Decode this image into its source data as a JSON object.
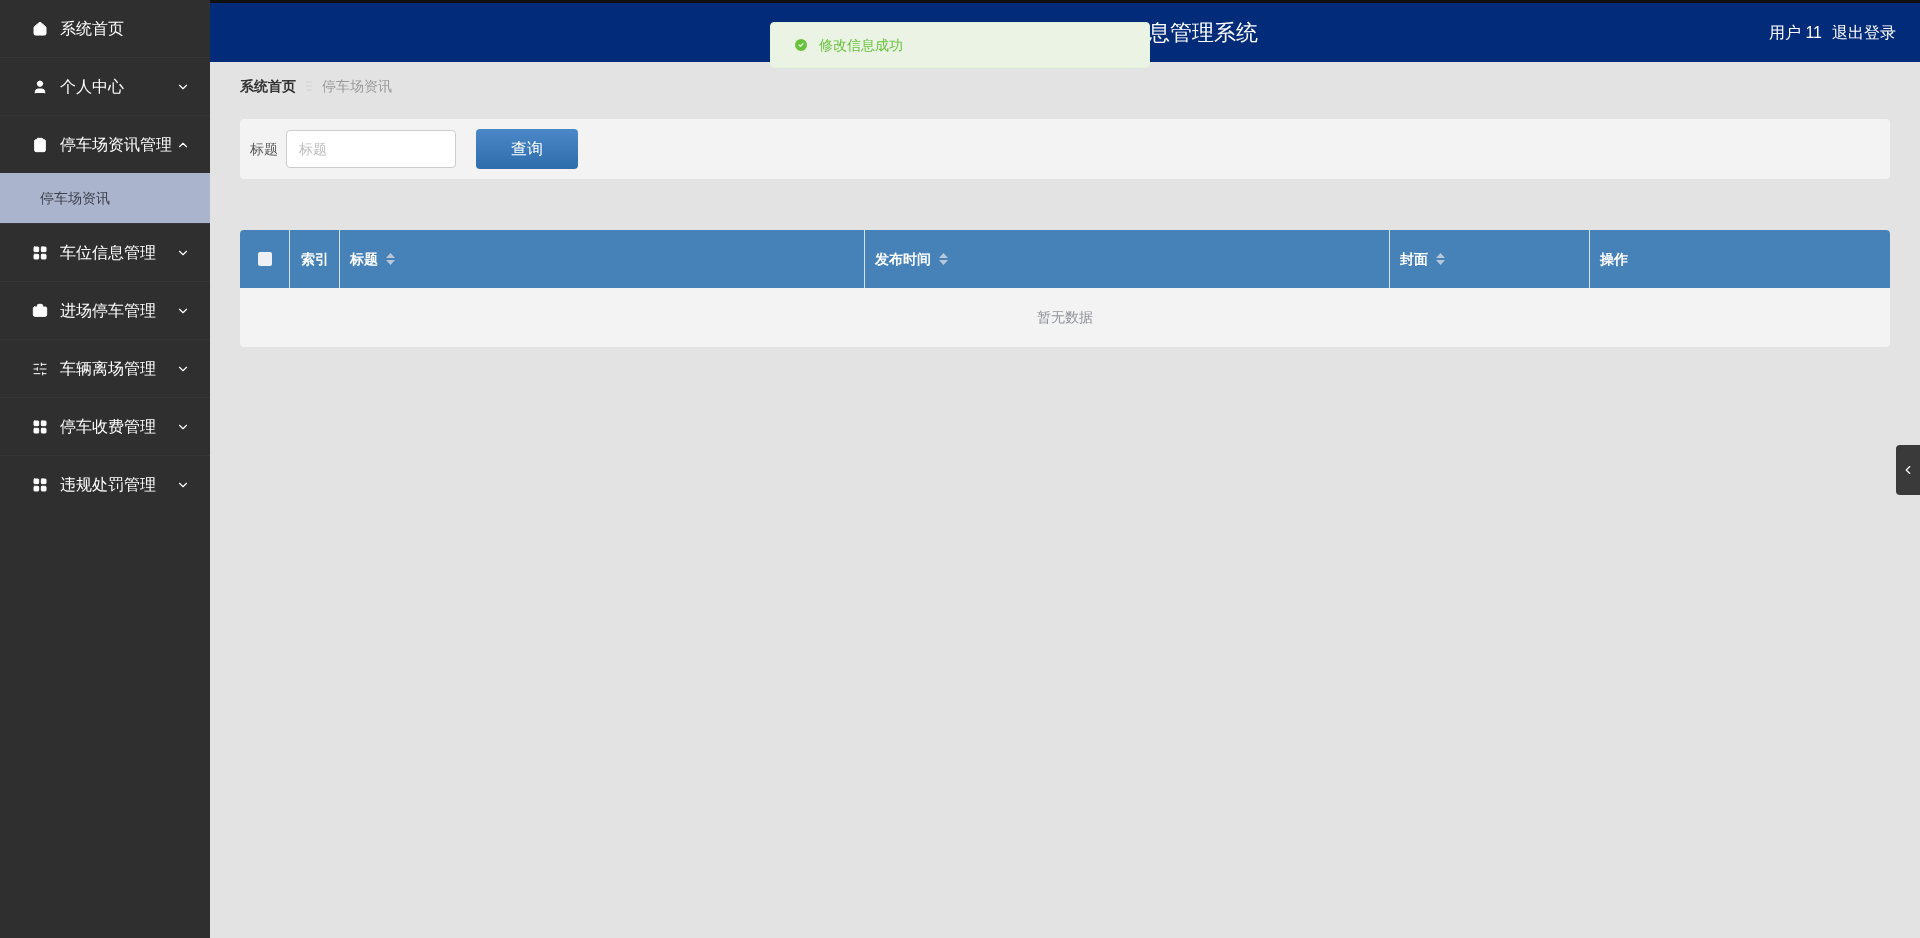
{
  "header": {
    "title": "息管理系统",
    "user": "用户 11",
    "logout": "退出登录"
  },
  "toast": {
    "message": "修改信息成功"
  },
  "sidebar": {
    "items": [
      {
        "label": "系统首页",
        "kind": "link"
      },
      {
        "label": "个人中心",
        "kind": "menu",
        "expanded": false
      },
      {
        "label": "停车场资讯管理",
        "kind": "menu",
        "expanded": true,
        "children": [
          {
            "label": "停车场资讯",
            "selected": true
          }
        ]
      },
      {
        "label": "车位信息管理",
        "kind": "menu",
        "expanded": false
      },
      {
        "label": "进场停车管理",
        "kind": "menu",
        "expanded": false
      },
      {
        "label": "车辆离场管理",
        "kind": "menu",
        "expanded": false
      },
      {
        "label": "停车收费管理",
        "kind": "menu",
        "expanded": false
      },
      {
        "label": "违规处罚管理",
        "kind": "menu",
        "expanded": false
      }
    ]
  },
  "breadcrumb": [
    "系统首页",
    "停车场资讯"
  ],
  "search": {
    "label": "标题",
    "placeholder": "标题",
    "button": "查询"
  },
  "table": {
    "select_all_checked": false,
    "columns": [
      {
        "label": "索引",
        "sortable": false
      },
      {
        "label": "标题",
        "sortable": true
      },
      {
        "label": "发布时间",
        "sortable": true
      },
      {
        "label": "封面",
        "sortable": true
      },
      {
        "label": "操作",
        "sortable": false
      }
    ],
    "empty_text": "暂无数据"
  }
}
